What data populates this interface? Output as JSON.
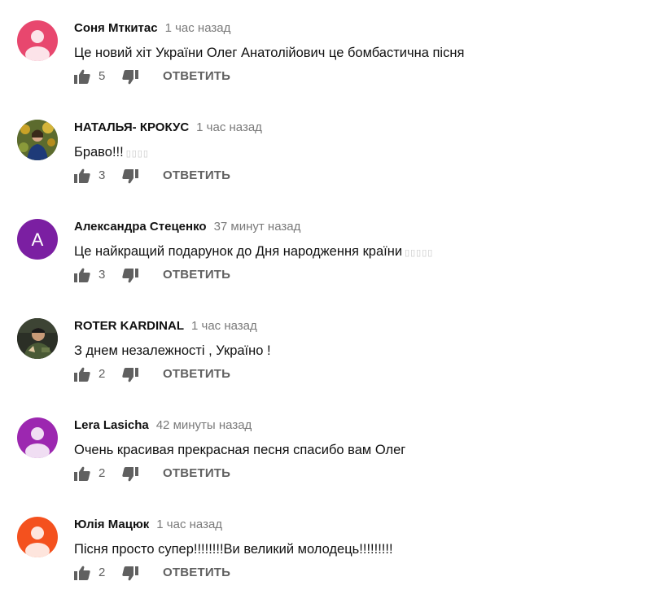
{
  "reply_label": "ОТВЕТИТЬ",
  "colors": {
    "author": "#111111",
    "timestamp": "#7a7a7a",
    "action": "#606060",
    "emoji_placeholder": "#c9c9c9"
  },
  "comments": [
    {
      "author": "Соня Мткитас",
      "time": "1 час назад",
      "text": "Це новий хіт України Олег Анатолійович це бомбастична пісня",
      "emoji": "",
      "likes": "5",
      "avatar": {
        "kind": "default-person",
        "bg": "#e8476e",
        "icon": "person-icon"
      }
    },
    {
      "author": "НАТАЛЬЯ- КРОКУС",
      "time": "1 час назад",
      "text": "Браво!!!",
      "emoji": "▯▯▯▯",
      "likes": "3",
      "avatar": {
        "kind": "photo",
        "bg": "#6a7a3a",
        "icon": "user-photo"
      }
    },
    {
      "author": "Александра Стеценко",
      "time": "37 минут назад",
      "text": "Це найкращий подарунок до Дня народження країни",
      "emoji": "▯▯▯▯▯",
      "likes": "3",
      "avatar": {
        "kind": "letter",
        "bg": "#7b1fa2",
        "letter": "A",
        "icon": "letter-avatar"
      }
    },
    {
      "author": "ROTER KARDINAL",
      "time": "1 час назад",
      "text": "З днем незалежності , Україно !",
      "emoji": "",
      "likes": "2",
      "avatar": {
        "kind": "photo-dark",
        "bg": "#2b2f26",
        "icon": "user-photo"
      }
    },
    {
      "author": "Lera Lasicha",
      "time": "42 минуты назад",
      "text": "Очень красивая прекрасная песня спасибо вам Олег",
      "emoji": "",
      "likes": "2",
      "avatar": {
        "kind": "default-person",
        "bg": "#9c27b0",
        "icon": "person-icon"
      }
    },
    {
      "author": "Юлія Мацюк",
      "time": "1 час назад",
      "text": "Пісня просто супер!!!!!!!!Ви великий молодець!!!!!!!!!",
      "emoji": "",
      "likes": "2",
      "avatar": {
        "kind": "default-person",
        "bg": "#f4511e",
        "icon": "person-icon"
      }
    }
  ]
}
